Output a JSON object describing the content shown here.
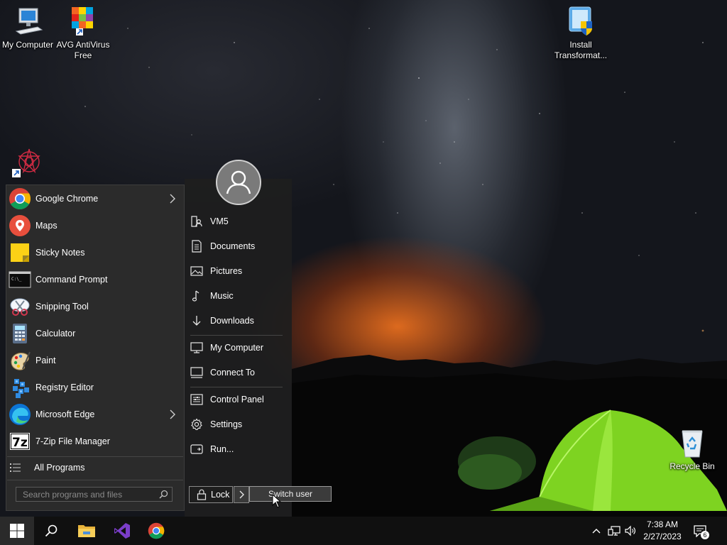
{
  "desktop": {
    "icons": [
      {
        "label": "My Computer",
        "icon": "computer-icon"
      },
      {
        "label": "AVG AntiVirus Free",
        "icon": "avg-icon"
      },
      {
        "label": "Install Transformat...",
        "icon": "installer-icon"
      },
      {
        "label": "",
        "icon": "app-shortcut-icon"
      },
      {
        "label": "Recycle Bin",
        "icon": "recycle-bin-icon"
      }
    ]
  },
  "start_menu": {
    "programs": [
      {
        "label": "Google Chrome",
        "icon": "chrome-icon",
        "has_submenu": true
      },
      {
        "label": "Maps",
        "icon": "maps-icon",
        "has_submenu": false
      },
      {
        "label": "Sticky Notes",
        "icon": "sticky-notes-icon",
        "has_submenu": false
      },
      {
        "label": "Command Prompt",
        "icon": "command-prompt-icon",
        "has_submenu": false
      },
      {
        "label": "Snipping Tool",
        "icon": "snipping-tool-icon",
        "has_submenu": false
      },
      {
        "label": "Calculator",
        "icon": "calculator-icon",
        "has_submenu": false
      },
      {
        "label": "Paint",
        "icon": "paint-icon",
        "has_submenu": false
      },
      {
        "label": "Registry Editor",
        "icon": "registry-editor-icon",
        "has_submenu": false
      },
      {
        "label": "Microsoft Edge",
        "icon": "edge-icon",
        "has_submenu": true
      },
      {
        "label": "7-Zip File Manager",
        "icon": "7zip-icon",
        "has_submenu": false
      }
    ],
    "all_programs": "All Programs",
    "search_placeholder": "Search programs and files",
    "places": [
      {
        "label": "VM5",
        "icon": "user-folder-icon"
      },
      {
        "label": "Documents",
        "icon": "document-icon"
      },
      {
        "label": "Pictures",
        "icon": "picture-icon"
      },
      {
        "label": "Music",
        "icon": "music-icon"
      },
      {
        "label": "Downloads",
        "icon": "download-icon"
      },
      {
        "label": "My Computer",
        "icon": "monitor-icon"
      },
      {
        "label": "Connect To",
        "icon": "connect-icon"
      },
      {
        "label": "Control Panel",
        "icon": "control-panel-icon"
      },
      {
        "label": "Settings",
        "icon": "gear-icon"
      },
      {
        "label": "Run...",
        "icon": "run-icon"
      }
    ],
    "lock_label": "Lock",
    "switch_user_label": "Switch user"
  },
  "taskbar": {
    "time": "7:38 AM",
    "date": "2/27/2023",
    "notification_count": "6"
  },
  "colors": {
    "menu_bg": "#2b2b2b",
    "taskbar_bg": "#101010",
    "tent_green": "#7ed321",
    "sunset_orange": "#ff7a1e"
  }
}
